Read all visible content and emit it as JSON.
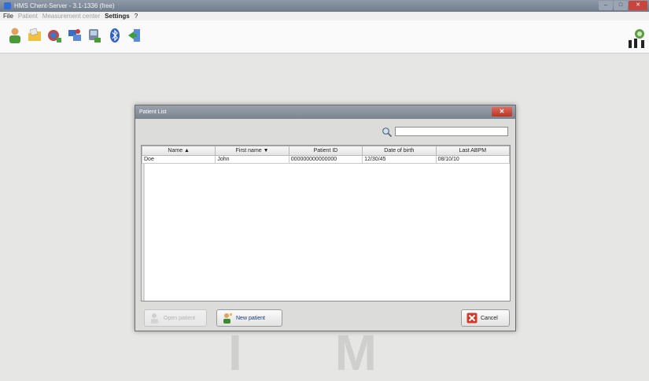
{
  "window": {
    "title": "HMS Chent-Server - 3.1-1336 (free)",
    "min_label": "–",
    "max_label": "□",
    "close_label": "✕"
  },
  "menu": {
    "items": [
      {
        "label": "File",
        "enabled": true
      },
      {
        "label": "Patient",
        "enabled": false
      },
      {
        "label": "Measurement center",
        "enabled": false
      },
      {
        "label": "Settings",
        "enabled": true
      },
      {
        "label": "?",
        "enabled": true
      }
    ]
  },
  "toolbar": {
    "buttons": [
      {
        "icon": "patient-icon"
      },
      {
        "icon": "folder-icon"
      },
      {
        "icon": "measurement-icon"
      },
      {
        "icon": "network-icon"
      },
      {
        "icon": "device-icon"
      },
      {
        "icon": "bluetooth-icon"
      },
      {
        "icon": "exit-icon"
      }
    ]
  },
  "watermark": {
    "text": "I M"
  },
  "dialog": {
    "title": "Patient List",
    "close_label": "✕",
    "search": {
      "value": "",
      "placeholder": ""
    },
    "table": {
      "columns": [
        "Name ▲",
        "First name ▼",
        "Patient ID",
        "Date of birth",
        "Last ABPM"
      ],
      "rows": [
        [
          "Doe",
          "John",
          "000000000000000",
          "12/30/45",
          "08/10/10"
        ]
      ]
    },
    "buttons": {
      "open_patient": "Open patient",
      "new_patient": "New patient",
      "cancel": "Cancel"
    }
  },
  "colors": {
    "accent_close": "#c9443a",
    "titlebar": "#7a848e",
    "background": "#e6e6e4"
  }
}
